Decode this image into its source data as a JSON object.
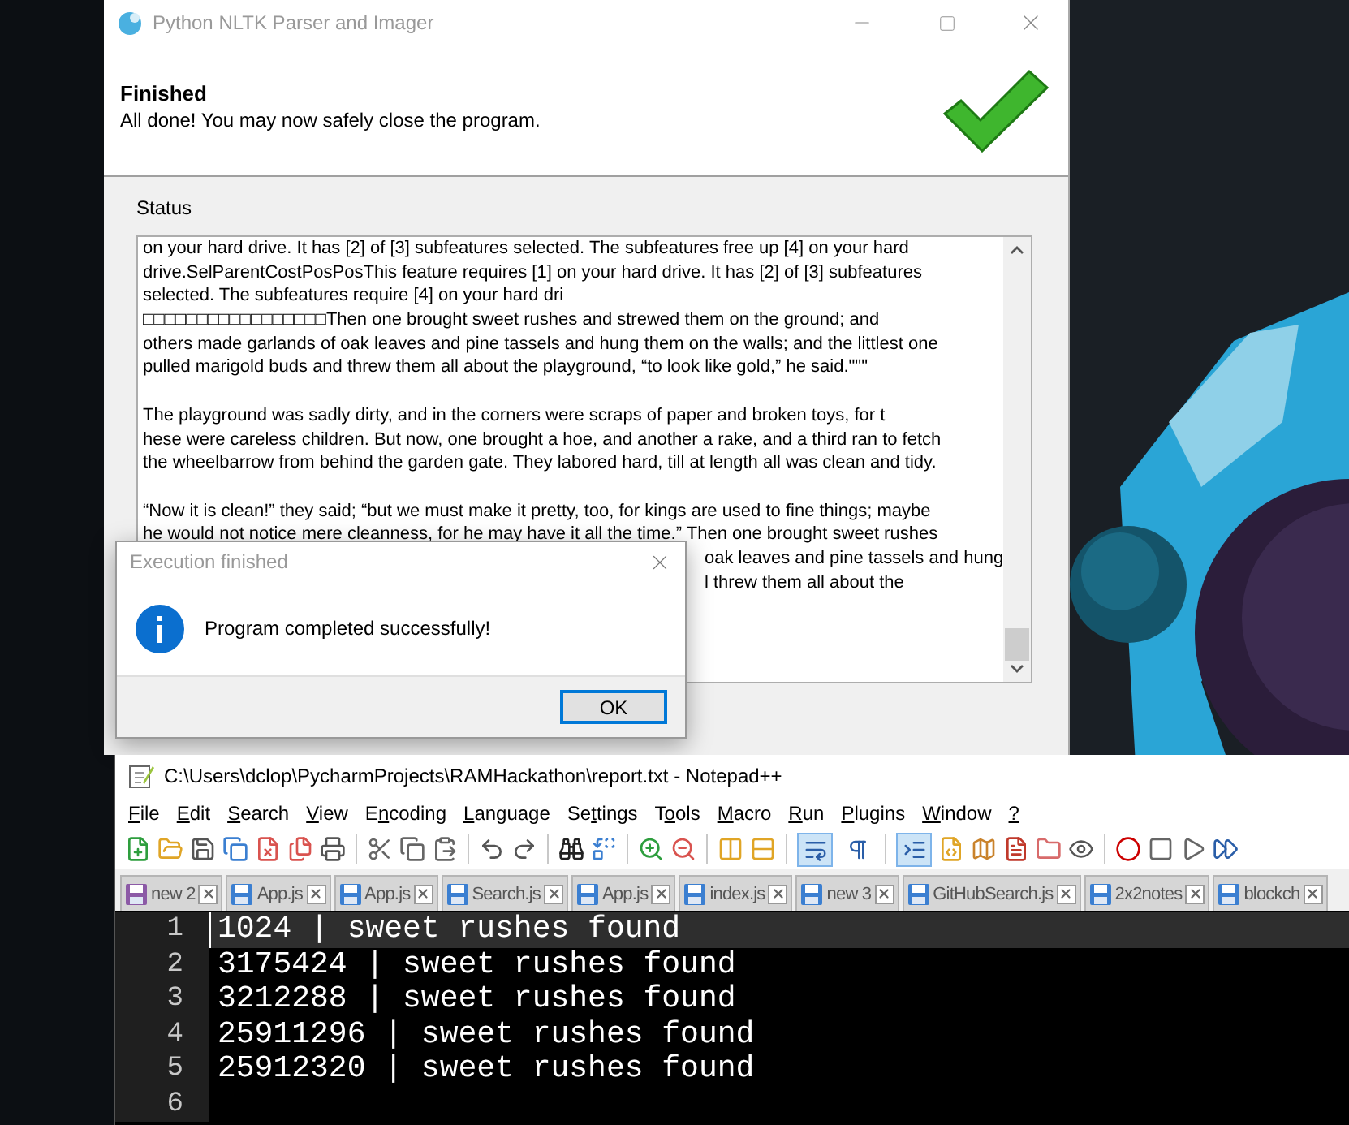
{
  "installer": {
    "title": "Python NLTK Parser and Imager",
    "heading": "Finished",
    "subheading": "All done! You may now safely close the program.",
    "status_label": "Status",
    "status_lines": [
      {
        "kind": "full",
        "text": "on your hard drive. It has [2] of [3] subfeatures selected. The subfeatures free up [4] on your hard"
      },
      {
        "kind": "full",
        "text": "drive.SelParentCostPosPosThis feature requires [1] on your hard drive. It has [2] of [3] subfeatures"
      },
      {
        "kind": "full",
        "text": "selected. The subfeatures require [4] on your hard dri"
      },
      {
        "kind": "full",
        "text": "□□□□□□□□□□□□□□□□□Then one brought sweet rushes and strewed them on the ground; and"
      },
      {
        "kind": "full",
        "text": "others made garlands of oak leaves and pine tassels and hung them on the walls; and the littlest one"
      },
      {
        "kind": "full",
        "text": "pulled marigold buds and threw them all about the playground, “to look like gold,” he said.\"\"\""
      },
      {
        "kind": "blank"
      },
      {
        "kind": "full",
        "text": "The playground was sadly dirty, and in the corners were scraps of paper and broken toys, for t"
      },
      {
        "kind": "full",
        "text": "hese were careless children. But now, one brought a hoe, and another a rake, and a third ran to fetch"
      },
      {
        "kind": "full",
        "text": "the wheelbarrow from behind the garden gate. They labored hard, till at length all was clean and tidy."
      },
      {
        "kind": "blank"
      },
      {
        "kind": "full",
        "text": "“Now it is clean!” they said; “but we must make it pretty, too, for kings are used to fine things; maybe"
      },
      {
        "kind": "full",
        "text": "he would not notice mere cleanness, for he may have it all the time.” Then one brought sweet rushes"
      },
      {
        "kind": "covered",
        "text": "oak leaves and pine tassels and hung"
      },
      {
        "kind": "covered",
        "text": "l threw them all about the"
      }
    ]
  },
  "dialog": {
    "title": "Execution finished",
    "message": "Program completed successfully!",
    "button": "OK"
  },
  "notepad": {
    "title": "C:\\Users\\dclop\\PycharmProjects\\RAMHackathon\\report.txt - Notepad++",
    "menu": [
      {
        "key": "F",
        "rest": "ile"
      },
      {
        "key": "E",
        "rest": "dit"
      },
      {
        "key": "S",
        "rest": "earch"
      },
      {
        "key": "V",
        "rest": "iew"
      },
      {
        "lead": "E",
        "key": "n",
        "rest": "coding"
      },
      {
        "key": "L",
        "rest": "anguage"
      },
      {
        "lead": "Se",
        "key": "t",
        "rest": "tings"
      },
      {
        "lead": "T",
        "key": "o",
        "rest": "ols"
      },
      {
        "key": "M",
        "rest": "acro"
      },
      {
        "key": "R",
        "rest": "un"
      },
      {
        "key": "P",
        "rest": "lugins"
      },
      {
        "key": "W",
        "rest": "indow"
      },
      {
        "key": "?"
      }
    ],
    "toolbar_toggles": [
      {
        "on": true
      },
      {
        "on": false
      },
      {
        "on": true
      }
    ],
    "tabs": [
      {
        "label": "new 2",
        "unsaved": true
      },
      {
        "label": "App.js",
        "unsaved": false
      },
      {
        "label": "App.js",
        "unsaved": false
      },
      {
        "label": "Search.js",
        "unsaved": false
      },
      {
        "label": "App.js",
        "unsaved": false
      },
      {
        "label": "index.js",
        "unsaved": false
      },
      {
        "label": "new 3",
        "unsaved": false
      },
      {
        "label": "GitHubSearch.js",
        "unsaved": false
      },
      {
        "label": "2x2notes",
        "unsaved": false
      },
      {
        "label": "blockch",
        "unsaved": false
      }
    ],
    "lines": [
      {
        "number": "1",
        "text": "1024 | sweet rushes found",
        "current": true
      },
      {
        "number": "2",
        "text": "3175424 | sweet rushes found",
        "current": false
      },
      {
        "number": "3",
        "text": "3212288 | sweet rushes found",
        "current": false
      },
      {
        "number": "4",
        "text": "25911296 | sweet rushes found",
        "current": false
      },
      {
        "number": "5",
        "text": "25912320 | sweet rushes found",
        "current": false
      },
      {
        "number": "6",
        "current": false
      }
    ]
  }
}
